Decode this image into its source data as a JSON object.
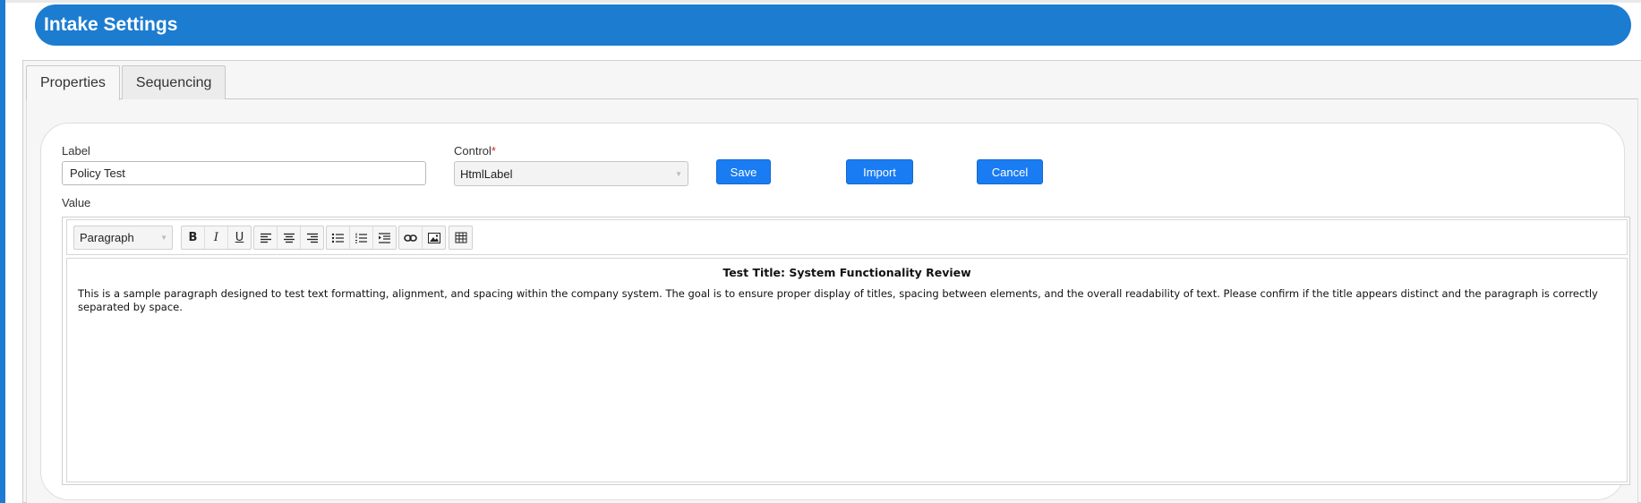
{
  "header": {
    "title": "Intake Settings"
  },
  "tabs": [
    {
      "label": "Properties",
      "active": true
    },
    {
      "label": "Sequencing",
      "active": false
    }
  ],
  "form": {
    "label_field": {
      "label": "Label",
      "value": "Policy Test"
    },
    "control_field": {
      "label": "Control",
      "required_marker": "*",
      "value": "HtmlLabel"
    },
    "value_label": "Value"
  },
  "buttons": {
    "save": "Save",
    "import": "Import",
    "cancel": "Cancel"
  },
  "editor": {
    "format_select": "Paragraph",
    "toolbar_icons": [
      "bold-icon",
      "italic-icon",
      "underline-icon",
      "align-left-icon",
      "align-center-icon",
      "align-right-icon",
      "bulleted-list-icon",
      "numbered-list-icon",
      "indent-icon",
      "link-icon",
      "image-icon",
      "table-icon"
    ],
    "content": {
      "title": "Test Title: System Functionality Review",
      "paragraph": "This is a sample paragraph designed to test text formatting, alignment, and spacing within the company system. The goal is to ensure proper display of titles, spacing between elements, and the overall readability of text. Please confirm if the title appears distinct and the paragraph is correctly separated by space."
    }
  },
  "colors": {
    "accent": "#1c7cd0",
    "button": "#1a7cf2",
    "required": "#e0261b"
  }
}
